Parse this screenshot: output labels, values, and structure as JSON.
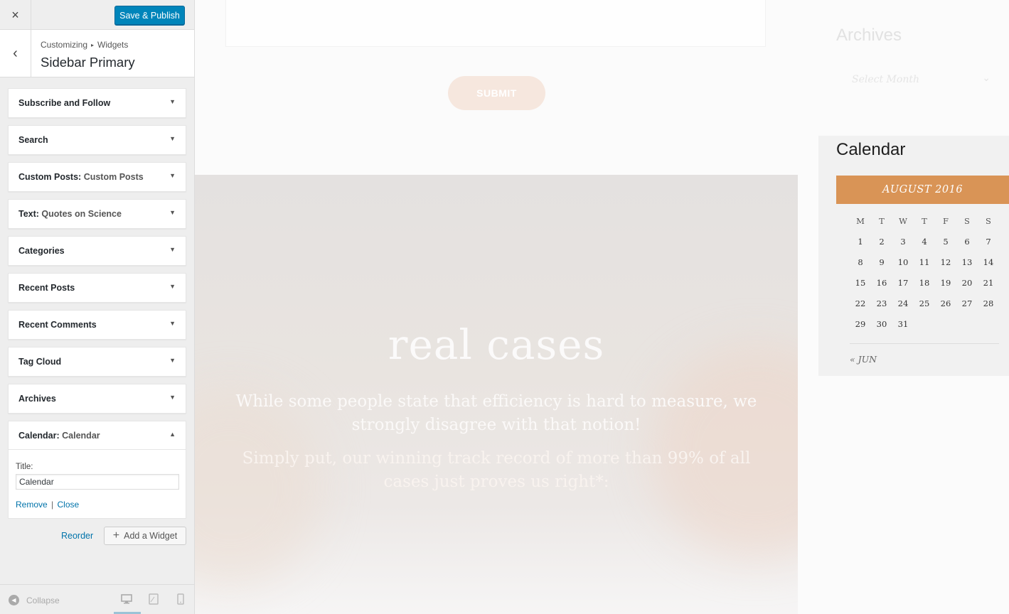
{
  "customizer": {
    "close_icon": "×",
    "publish_label": "Save & Publish",
    "back_icon": "‹",
    "breadcrumb": {
      "first": "Customizing",
      "separator": "▸",
      "second": "Widgets"
    },
    "section_title": "Sidebar Primary",
    "widgets": [
      {
        "title": "Subscribe and Follow",
        "subtitle": ""
      },
      {
        "title": "Search",
        "subtitle": ""
      },
      {
        "title": "Custom Posts:",
        "subtitle": "Custom Posts"
      },
      {
        "title": "Text:",
        "subtitle": "Quotes on Science"
      },
      {
        "title": "Categories",
        "subtitle": ""
      },
      {
        "title": "Recent Posts",
        "subtitle": ""
      },
      {
        "title": "Recent Comments",
        "subtitle": ""
      },
      {
        "title": "Tag Cloud",
        "subtitle": ""
      },
      {
        "title": "Archives",
        "subtitle": ""
      }
    ],
    "calendar_widget": {
      "title": "Calendar:",
      "subtitle": "Calendar",
      "field_label": "Title:",
      "field_value": "Calendar",
      "remove_label": "Remove",
      "separator": "|",
      "close_label": "Close"
    },
    "reorder_label": "Reorder",
    "add_widget_label": "Add a Widget",
    "collapse_label": "Collapse"
  },
  "preview": {
    "submit_label": "SUBMIT",
    "hero": {
      "title": "real cases",
      "paragraph1": "While some people state that efficiency is hard to measure, we strongly disagree with that notion!",
      "paragraph2": "Simply put, our winning track record of more than 99% of all cases just proves us right*:"
    },
    "archives": {
      "title": "Archives",
      "select_placeholder": "Select Month"
    },
    "calendar": {
      "heading": "Calendar",
      "month": "AUGUST 2016",
      "weekdays": [
        "M",
        "T",
        "W",
        "T",
        "F",
        "S",
        "S"
      ],
      "weeks": [
        [
          "1",
          "2",
          "3",
          "4",
          "5",
          "6",
          "7"
        ],
        [
          "8",
          "9",
          "10",
          "11",
          "12",
          "13",
          "14"
        ],
        [
          "15",
          "16",
          "17",
          "18",
          "19",
          "20",
          "21"
        ],
        [
          "22",
          "23",
          "24",
          "25",
          "26",
          "27",
          "28"
        ],
        [
          "29",
          "30",
          "31",
          "",
          "",
          "",
          ""
        ]
      ],
      "prev_link": "« JUN"
    }
  },
  "colors": {
    "primary_button": "#0085ba",
    "link": "#0073aa",
    "calendar_header": "#d99456",
    "submit_button": "#f6e7de"
  }
}
